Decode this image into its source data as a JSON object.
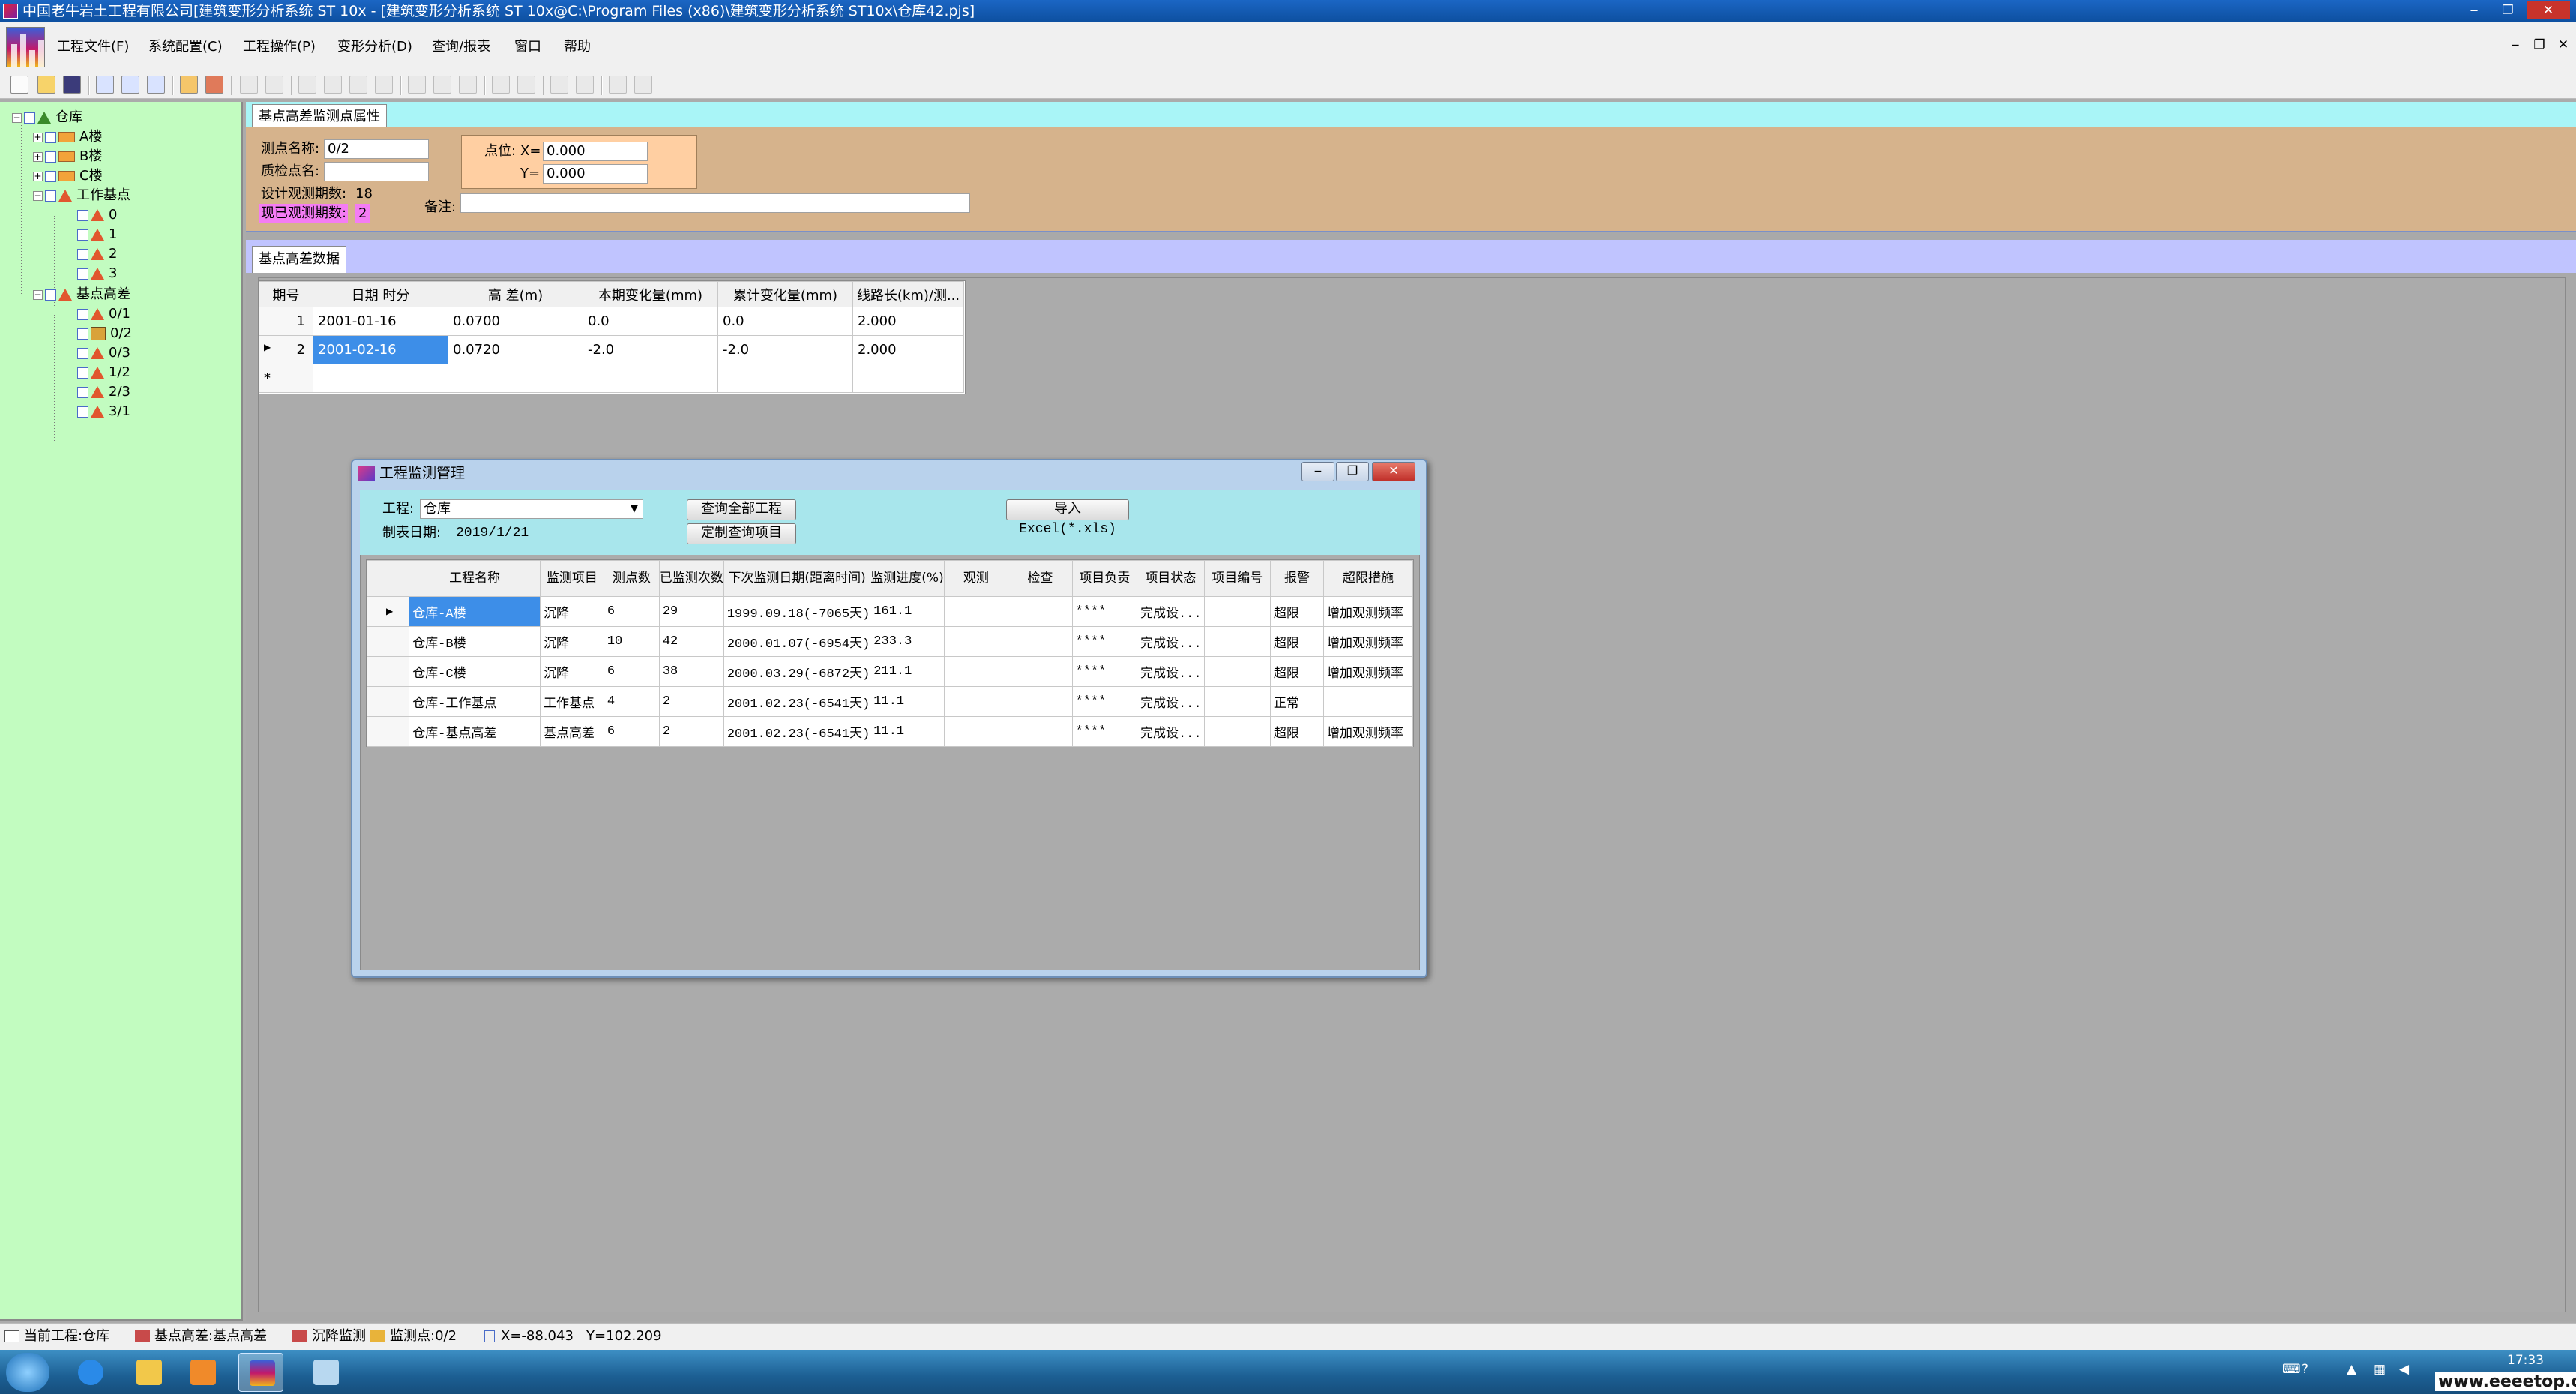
{
  "window": {
    "title": "中国老牛岩土工程有限公司[建筑变形分析系统 ST 10x - [建筑变形分析系统 ST 10x@C:\\Program Files (x86)\\建筑变形分析系统 ST10x\\仓库42.pjs]",
    "minimize": "‒",
    "restore": "❐",
    "close": "✕"
  },
  "menu": {
    "items": [
      "工程文件(F)",
      "系统配置(C)",
      "工程操作(P)",
      "变形分析(D)",
      "查询/报表",
      "窗口",
      "帮助"
    ],
    "mdi_min": "‒",
    "mdi_restore": "❐",
    "mdi_close": "✕"
  },
  "tree": {
    "root": "仓库",
    "buildings": [
      "A楼",
      "B楼",
      "C楼"
    ],
    "work_base": "工作基点",
    "work_points": [
      "0",
      "1",
      "2",
      "3"
    ],
    "base_diff": "基点高差",
    "base_points": [
      "0/1",
      "0/2",
      "0/3",
      "1/2",
      "2/3",
      "3/1"
    ]
  },
  "props": {
    "tab": "基点高差监测点属性",
    "point_name_label": "测点名称:",
    "point_name": "0/2",
    "check_point_label": "质检点名:",
    "check_point": "",
    "design_label": "设计观测期数:",
    "design_count": "18",
    "observed_label": "现已观测期数:",
    "observed_count": "2",
    "position_label": "点位:",
    "x_label": "X=",
    "x_value": "0.000",
    "y_label": "Y=",
    "y_value": "0.000",
    "note_label": "备注:",
    "note": ""
  },
  "data_section": {
    "tab": "基点高差数据",
    "columns": [
      "期号",
      "日期 时分",
      "高 差(m)",
      "本期变化量(mm)",
      "累计变化量(mm)",
      "线路长(km)/测..."
    ],
    "rows": [
      [
        "1",
        "2001-01-16",
        "0.0700",
        "0.0",
        "0.0",
        "2.000"
      ],
      [
        "2",
        "2001-02-16",
        "0.0720",
        "-2.0",
        "-2.0",
        "2.000"
      ]
    ],
    "new_row_marker": "*",
    "current_marker": "▶"
  },
  "dialog": {
    "title": "工程监测管理",
    "project_label": "工程:",
    "project_value": "仓库",
    "date_label": "制表日期:",
    "date_value": "2019/1/21",
    "btn_query_all": "查询全部工程",
    "btn_custom_query": "定制查询项目",
    "btn_export": "导入Excel(*.xls)",
    "columns": [
      "",
      "工程名称",
      "监测项目",
      "测点数",
      "已监测次数",
      "下次监测日期(距离时间)",
      "监测进度(%)",
      "观测",
      "检查",
      "项目负责",
      "项目状态",
      "项目编号",
      "报警",
      "超限措施"
    ],
    "rows": [
      [
        "▶",
        "仓库-A楼",
        "沉降",
        "6",
        "29",
        "1999.09.18(-7065天)",
        "161.1",
        "",
        "",
        "****",
        "完成设...",
        "",
        "超限",
        "增加观测频率"
      ],
      [
        "",
        "仓库-B楼",
        "沉降",
        "10",
        "42",
        "2000.01.07(-6954天)",
        "233.3",
        "",
        "",
        "****",
        "完成设...",
        "",
        "超限",
        "增加观测频率"
      ],
      [
        "",
        "仓库-C楼",
        "沉降",
        "6",
        "38",
        "2000.03.29(-6872天)",
        "211.1",
        "",
        "",
        "****",
        "完成设...",
        "",
        "超限",
        "增加观测频率"
      ],
      [
        "",
        "仓库-工作基点",
        "工作基点",
        "4",
        "2",
        "2001.02.23(-6541天)",
        "11.1",
        "",
        "",
        "****",
        "完成设...",
        "",
        "正常",
        ""
      ],
      [
        "",
        "仓库-基点高差",
        "基点高差",
        "6",
        "2",
        "2001.02.23(-6541天)",
        "11.1",
        "",
        "",
        "****",
        "完成设...",
        "",
        "超限",
        "增加观测频率"
      ]
    ]
  },
  "status": {
    "project": "当前工程:仓库",
    "section": "基点高差:基点高差",
    "monitor": "沉降监测",
    "point": "监测点:0/2",
    "coords": "X=-88.043   Y=102.209"
  },
  "taskbar": {
    "clock": "17:33",
    "watermark": "www.eeeetop.com"
  },
  "colors": {
    "title_bar": "#0d4f9f",
    "tree_bg": "#c2fcc0",
    "props_bg": "#d6b38c",
    "selection": "#3d8ee8",
    "dialog_top": "#a8e6ec"
  }
}
